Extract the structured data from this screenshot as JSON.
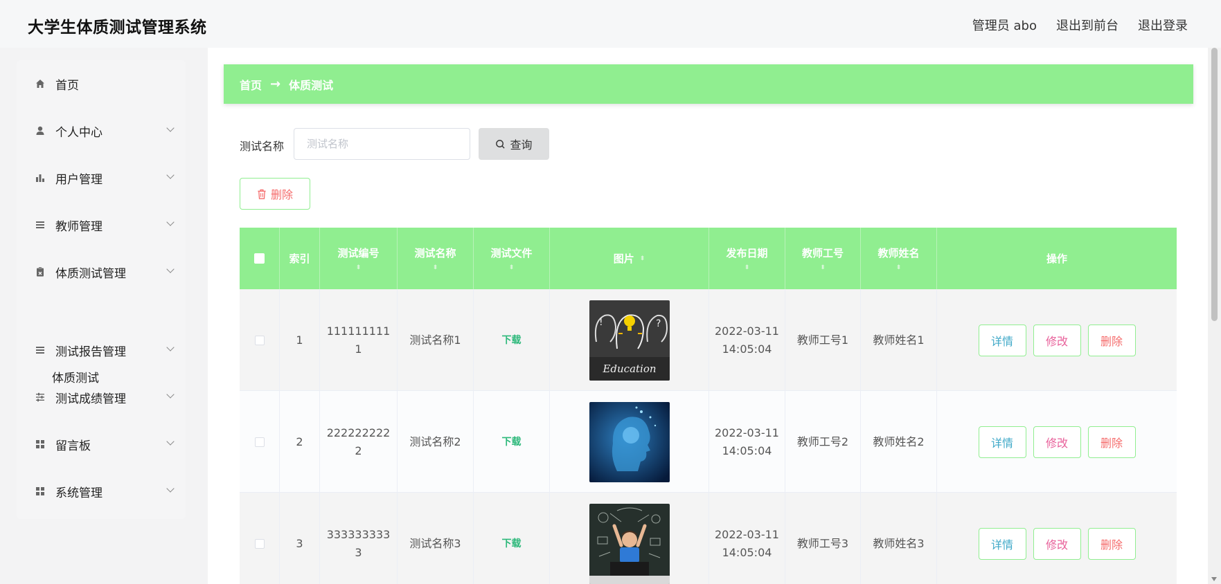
{
  "app": {
    "title": "大学生体质测试管理系统"
  },
  "header": {
    "user_label": "管理员 abo",
    "to_front": "退出到前台",
    "logout": "退出登录"
  },
  "sidebar": {
    "items": [
      {
        "label": "首页",
        "icon": "home-icon"
      },
      {
        "label": "个人中心",
        "icon": "user-icon"
      },
      {
        "label": "用户管理",
        "icon": "bar-chart-icon"
      },
      {
        "label": "教师管理",
        "icon": "list-icon"
      },
      {
        "label": "体质测试管理",
        "icon": "clipboard-icon"
      },
      {
        "label": "测试报告管理",
        "icon": "list-icon"
      },
      {
        "label": "测试成绩管理",
        "icon": "sliders-icon"
      },
      {
        "label": "留言板",
        "icon": "grid-icon"
      },
      {
        "label": "系统管理",
        "icon": "grid-icon"
      }
    ],
    "submenu": {
      "label": "体质测试"
    }
  },
  "breadcrumb": {
    "home": "首页",
    "arrow": "→",
    "current": "体质测试"
  },
  "search": {
    "label": "测试名称",
    "placeholder": "测试名称",
    "button": "查询"
  },
  "toolbar": {
    "delete_label": "删除"
  },
  "table": {
    "headers": {
      "index": "索引",
      "code": "测试编号",
      "name": "测试名称",
      "file": "测试文件",
      "image": "图片",
      "date": "发布日期",
      "teacher_id": "教师工号",
      "teacher_name": "教师姓名",
      "ops": "操作"
    },
    "sort_glyph": "⬍",
    "rows": [
      {
        "index": "1",
        "code_a": "111111111",
        "code_b": "1",
        "name": "测试名称1",
        "file": "下载",
        "image": "education-photo",
        "date_a": "2022-03-11",
        "date_b": "14:05:04",
        "teacher_id": "教师工号1",
        "teacher_name": "教师姓名1"
      },
      {
        "index": "2",
        "code_a": "222222222",
        "code_b": "2",
        "name": "测试名称2",
        "file": "下载",
        "image": "digital-head-photo",
        "date_a": "2022-03-11",
        "date_b": "14:05:04",
        "teacher_id": "教师工号2",
        "teacher_name": "教师姓名2"
      },
      {
        "index": "3",
        "code_a": "333333333",
        "code_b": "3",
        "name": "测试名称3",
        "file": "下载",
        "image": "chalkboard-kid-photo",
        "date_a": "2022-03-11",
        "date_b": "14:05:04",
        "teacher_id": "教师工号3",
        "teacher_name": "教师姓名3"
      }
    ],
    "actions": {
      "detail": "详情",
      "edit": "修改",
      "remove": "删除"
    }
  },
  "colors": {
    "accent": "#90ee90",
    "danger": "#f56c6c",
    "download": "#2cb87a",
    "detail": "#40a9c8",
    "edit": "#e8609a"
  }
}
